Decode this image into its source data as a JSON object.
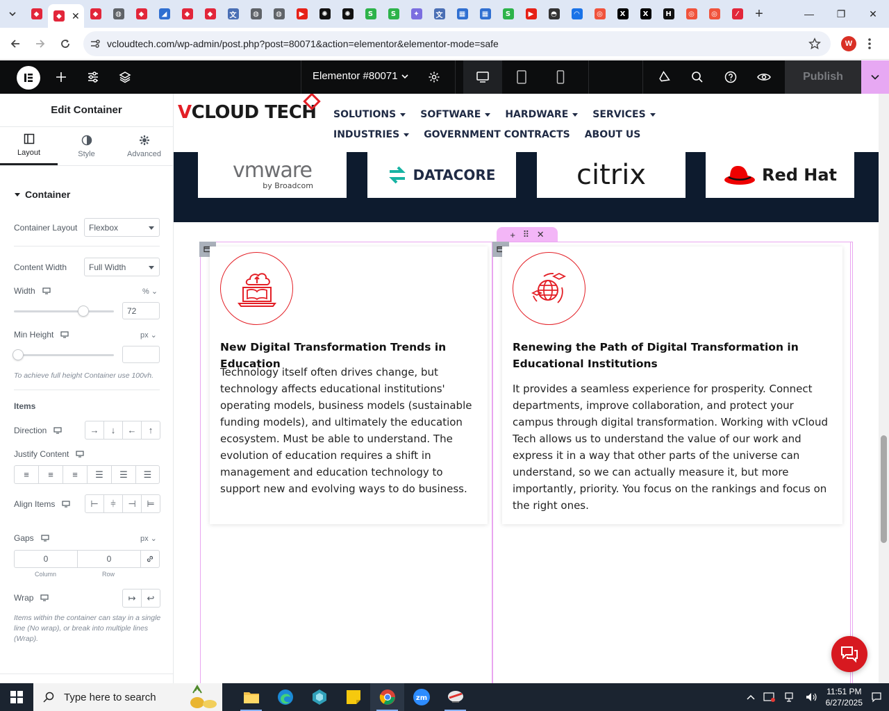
{
  "browser": {
    "tab_favicons": [
      {
        "icon": "elementor-icon",
        "color": "#e2263a",
        "glyph": "◆"
      },
      {
        "icon": "elementor-icon",
        "color": "#e2263a",
        "glyph": "◆"
      },
      {
        "icon": "elementor-icon",
        "color": "#e2263a",
        "glyph": "◆"
      },
      {
        "icon": "globe-icon",
        "color": "#5f6368",
        "glyph": "◍"
      },
      {
        "icon": "elementor-icon",
        "color": "#e2263a",
        "glyph": "◆"
      },
      {
        "icon": "azure-icon",
        "color": "#2f6fd1",
        "glyph": "◢"
      },
      {
        "icon": "elementor-icon",
        "color": "#e2263a",
        "glyph": "◆"
      },
      {
        "icon": "elementor-icon",
        "color": "#e2263a",
        "glyph": "◆"
      },
      {
        "icon": "translate-icon",
        "color": "#4a6fb5",
        "glyph": "文"
      },
      {
        "icon": "globe-icon",
        "color": "#5f6368",
        "glyph": "◍"
      },
      {
        "icon": "globe-icon",
        "color": "#5f6368",
        "glyph": "◍"
      },
      {
        "icon": "youtube-icon",
        "color": "#e62117",
        "glyph": "▶"
      },
      {
        "icon": "openai-icon",
        "color": "#111111",
        "glyph": "✺"
      },
      {
        "icon": "openai-icon",
        "color": "#111111",
        "glyph": "✺"
      },
      {
        "icon": "green-s-icon",
        "color": "#2db34a",
        "glyph": "S"
      },
      {
        "icon": "green-s-icon",
        "color": "#2db34a",
        "glyph": "S"
      },
      {
        "icon": "gemini-icon",
        "color": "#7b6ee0",
        "glyph": "✦"
      },
      {
        "icon": "translate-icon",
        "color": "#4a6fb5",
        "glyph": "文"
      },
      {
        "icon": "grid-icon",
        "color": "#2f6fd1",
        "glyph": "▦"
      },
      {
        "icon": "grid-icon",
        "color": "#2f6fd1",
        "glyph": "▦"
      },
      {
        "icon": "green-s-icon",
        "color": "#2db34a",
        "glyph": "S"
      },
      {
        "icon": "youtube-icon",
        "color": "#e62117",
        "glyph": "▶"
      },
      {
        "icon": "incognito-icon",
        "color": "#333333",
        "glyph": "◓"
      },
      {
        "icon": "cloud-icon",
        "color": "#1a73e8",
        "glyph": "◠"
      },
      {
        "icon": "circle-icon",
        "color": "#f0533c",
        "glyph": "◎"
      },
      {
        "icon": "x-icon",
        "color": "#000000",
        "glyph": "X"
      },
      {
        "icon": "x-icon",
        "color": "#000000",
        "glyph": "X"
      },
      {
        "icon": "h-icon",
        "color": "#111111",
        "glyph": "H"
      },
      {
        "icon": "circle-icon",
        "color": "#f0533c",
        "glyph": "◎"
      },
      {
        "icon": "circle-icon",
        "color": "#f0533c",
        "glyph": "◎"
      },
      {
        "icon": "pen-icon",
        "color": "#e2263a",
        "glyph": "⁄"
      }
    ],
    "active_tab_index": 1,
    "url": "vcloudtech.com/wp-admin/post.php?post=80071&action=elementor&elementor-mode=safe",
    "profile_initial": "W"
  },
  "editor": {
    "document_title": "Elementor #80071",
    "publish_label": "Publish"
  },
  "panel": {
    "title": "Edit Container",
    "tabs": [
      {
        "label": "Layout"
      },
      {
        "label": "Style"
      },
      {
        "label": "Advanced"
      }
    ],
    "section_title": "Container",
    "container_layout": {
      "label": "Container Layout",
      "value": "Flexbox"
    },
    "content_width": {
      "label": "Content Width",
      "value": "Full Width"
    },
    "width": {
      "label": "Width",
      "unit": "%",
      "value": "72",
      "fraction": 0.72
    },
    "min_height": {
      "label": "Min Height",
      "unit": "px",
      "value": "",
      "fraction": 0,
      "hint": "To achieve full height Container use 100vh."
    },
    "items_title": "Items",
    "direction_label": "Direction",
    "justify_label": "Justify Content",
    "align_label": "Align Items",
    "gaps": {
      "label": "Gaps",
      "unit": "px",
      "column": "0",
      "row": "0",
      "column_label": "Column",
      "row_label": "Row"
    },
    "wrap": {
      "label": "Wrap",
      "hint": "Items within the container can stay in a single line (No wrap), or break into multiple lines (Wrap)."
    }
  },
  "site": {
    "brand": {
      "part1": "V",
      "part2": "CLOUD TECH"
    },
    "nav": [
      {
        "label": "SOLUTIONS",
        "dropdown": true
      },
      {
        "label": "SOFTWARE",
        "dropdown": true
      },
      {
        "label": "HARDWARE",
        "dropdown": true
      },
      {
        "label": "SERVICES",
        "dropdown": true
      },
      {
        "label": "INDUSTRIES",
        "dropdown": true
      },
      {
        "label": "GOVERNMENT CONTRACTS",
        "dropdown": false
      },
      {
        "label": "ABOUT US",
        "dropdown": false
      }
    ],
    "partners": {
      "vmware": {
        "name": "vmware",
        "sub": "by Broadcom"
      },
      "datacore": {
        "name": "DATACORE"
      },
      "citrix": {
        "name": "citrix"
      },
      "redhat": {
        "name": "Red Hat"
      }
    },
    "cards": [
      {
        "title": "New Digital Transformation Trends in Education",
        "body": "Technology itself often drives change, but technology affects educational institutions' operating models, business models (sustainable funding models), and ultimately the education ecosystem. Must be able to understand. The evolution of education requires a shift in management and education technology to support new and evolving ways to do business."
      },
      {
        "title": "Renewing the Path of Digital Transformation in Educational Institutions",
        "body": "It provides a seamless experience for prosperity. Connect departments, improve collaboration, and protect your campus through digital transformation. Working with vCloud Tech allows us to understand the value of our work and express it in a way that other parts of the universe can understand, so we can actually measure it, but more importantly, priority. You focus on the rankings and focus on the right ones."
      }
    ],
    "accent_color": "#e31f26"
  },
  "taskbar": {
    "search_placeholder": "Type here to search",
    "time": "11:51 PM",
    "date": "6/27/2025"
  }
}
